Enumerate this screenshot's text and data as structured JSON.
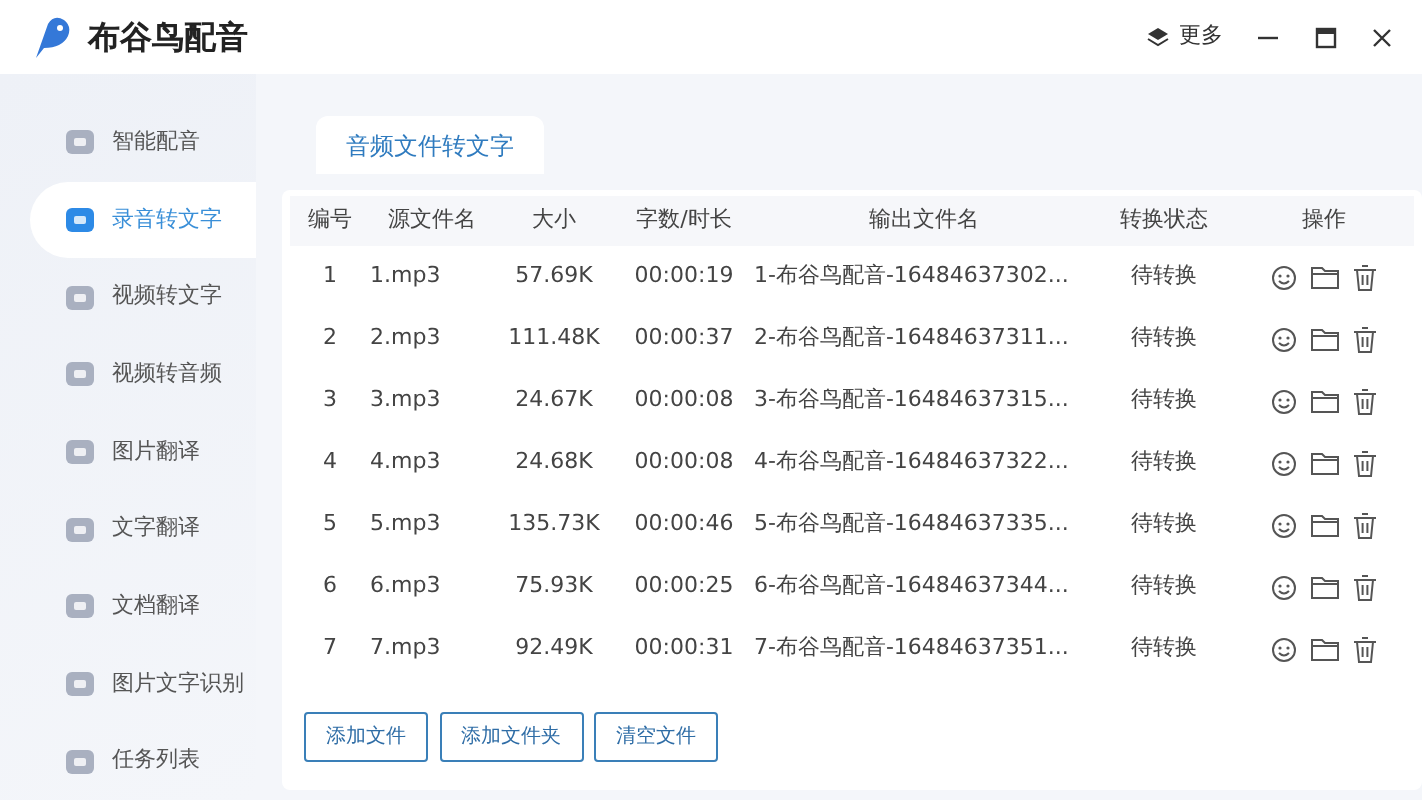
{
  "window": {
    "title": "布谷鸟配音",
    "more_button": "更多"
  },
  "sidebar": {
    "items": [
      {
        "label": "智能配音",
        "selected": false
      },
      {
        "label": "录音转文字",
        "selected": true
      },
      {
        "label": "视频转文字",
        "selected": false
      },
      {
        "label": "视频转音频",
        "selected": false
      },
      {
        "label": "图片翻译",
        "selected": false
      },
      {
        "label": "文字翻译",
        "selected": false
      },
      {
        "label": "文档翻译",
        "selected": false
      },
      {
        "label": "图片文字识别",
        "selected": false
      },
      {
        "label": "任务列表",
        "selected": false
      }
    ]
  },
  "tabs": [
    {
      "label": "音频文件转文字",
      "selected": true
    }
  ],
  "table": {
    "columns": [
      "编号",
      "源文件名",
      "大小",
      "字数/时长",
      "输出文件名",
      "转换状态",
      "操作"
    ],
    "rows": [
      [
        "1",
        "1.mp3",
        "57.69K",
        "00:00:19",
        "1-布谷鸟配音-16484637302...",
        "待转换"
      ],
      [
        "2",
        "2.mp3",
        "111.48K",
        "00:00:37",
        "2-布谷鸟配音-16484637311...",
        "待转换"
      ],
      [
        "3",
        "3.mp3",
        "24.67K",
        "00:00:08",
        "3-布谷鸟配音-16484637315...",
        "待转换"
      ],
      [
        "4",
        "4.mp3",
        "24.68K",
        "00:00:08",
        "4-布谷鸟配音-16484637322...",
        "待转换"
      ],
      [
        "5",
        "5.mp3",
        "135.73K",
        "00:00:46",
        "5-布谷鸟配音-16484637335...",
        "待转换"
      ],
      [
        "6",
        "6.mp3",
        "75.93K",
        "00:00:25",
        "6-布谷鸟配音-16484637344...",
        "待转换"
      ],
      [
        "7",
        "7.mp3",
        "92.49K",
        "00:00:31",
        "7-布谷鸟配音-16484637351...",
        "待转换"
      ]
    ]
  },
  "buttons": [
    "添加文件",
    "添加文件夹",
    "清空文件"
  ]
}
